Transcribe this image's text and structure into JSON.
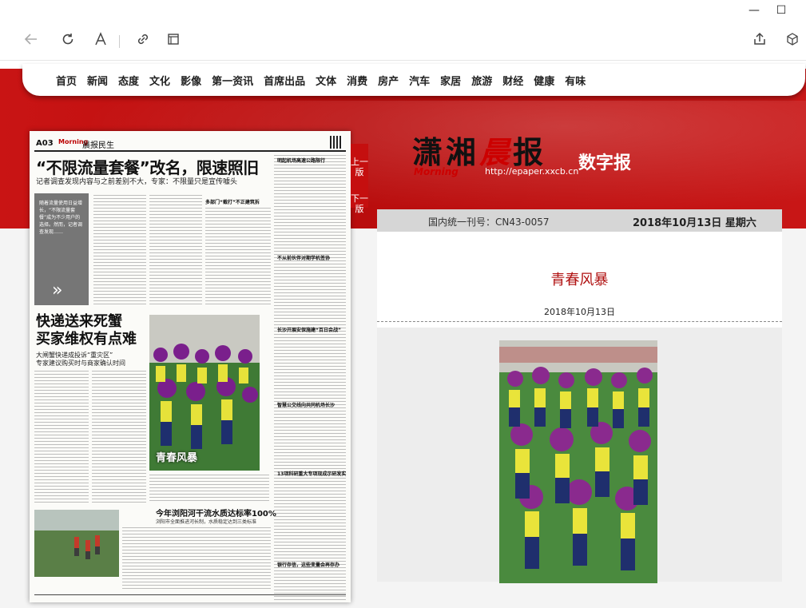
{
  "window": {
    "minimize_glyph": "—",
    "maximize_glyph": "☐"
  },
  "toolbar": {
    "icons": [
      "back-icon",
      "refresh-icon",
      "read-aloud-icon",
      "link-icon",
      "reading-view-icon",
      "share-icon",
      "extensions-icon"
    ]
  },
  "nav": {
    "items": [
      "首页",
      "新闻",
      "态度",
      "文化",
      "影像",
      "第一资讯",
      "首席出品",
      "文体",
      "消费",
      "房产",
      "汽车",
      "家居",
      "旅游",
      "财经",
      "健康",
      "有味"
    ]
  },
  "paper": {
    "page_no": "A03",
    "logo": "Morning",
    "section": "晨报民生",
    "headline1": "“不限流量套餐”改名，限速照旧",
    "sub1": "记者调查发现内容与之前差别不大，专家：不限量只是宣传噱头",
    "sidebar_text": "随着流量使用日益增长，“不限流量套餐”成为不少用户的选择。然而，记者调查发现……",
    "headline2_line1": "快递送来死蟹",
    "headline2_line2": "买家维权有点难",
    "sub2_line1": "大闸蟹快递成投诉“重灾区”",
    "sub2_line2": "专家建议购买时与商家确认时间",
    "photo_caption": "青春风暴",
    "headline3": "今年浏阳河干流水质达标率100%",
    "sub3": "浏阳市全面推进河长制，水质稳定达到三类标准",
    "right_heads": [
      "明起机场高速公路限行",
      "多部门“截打”不正建筑拆",
      "不从前伙伴对期学机签协",
      "长沙开展安保施建“百日会战”",
      "智慧公交线向共同机场长沙",
      "13项科研重大专项现成示研发实",
      "银行存信，这些变量会再存办"
    ]
  },
  "side_tab": {
    "prev": "上一版",
    "next": "下一版"
  },
  "masthead": {
    "name_part1": "潇湘",
    "name_part2": "晨",
    "name_part3": "报",
    "english": "Morning",
    "url": "http://epaper.xxcb.cn",
    "digital": "数字报"
  },
  "info": {
    "issn": "国内统一刊号：CN43-0057",
    "date": "2018年10月13日 星期六"
  },
  "article": {
    "title": "青春风暴",
    "date": "2018年10月13日"
  },
  "colors": {
    "brand_red": "#c91414",
    "title_red": "#b01212"
  }
}
